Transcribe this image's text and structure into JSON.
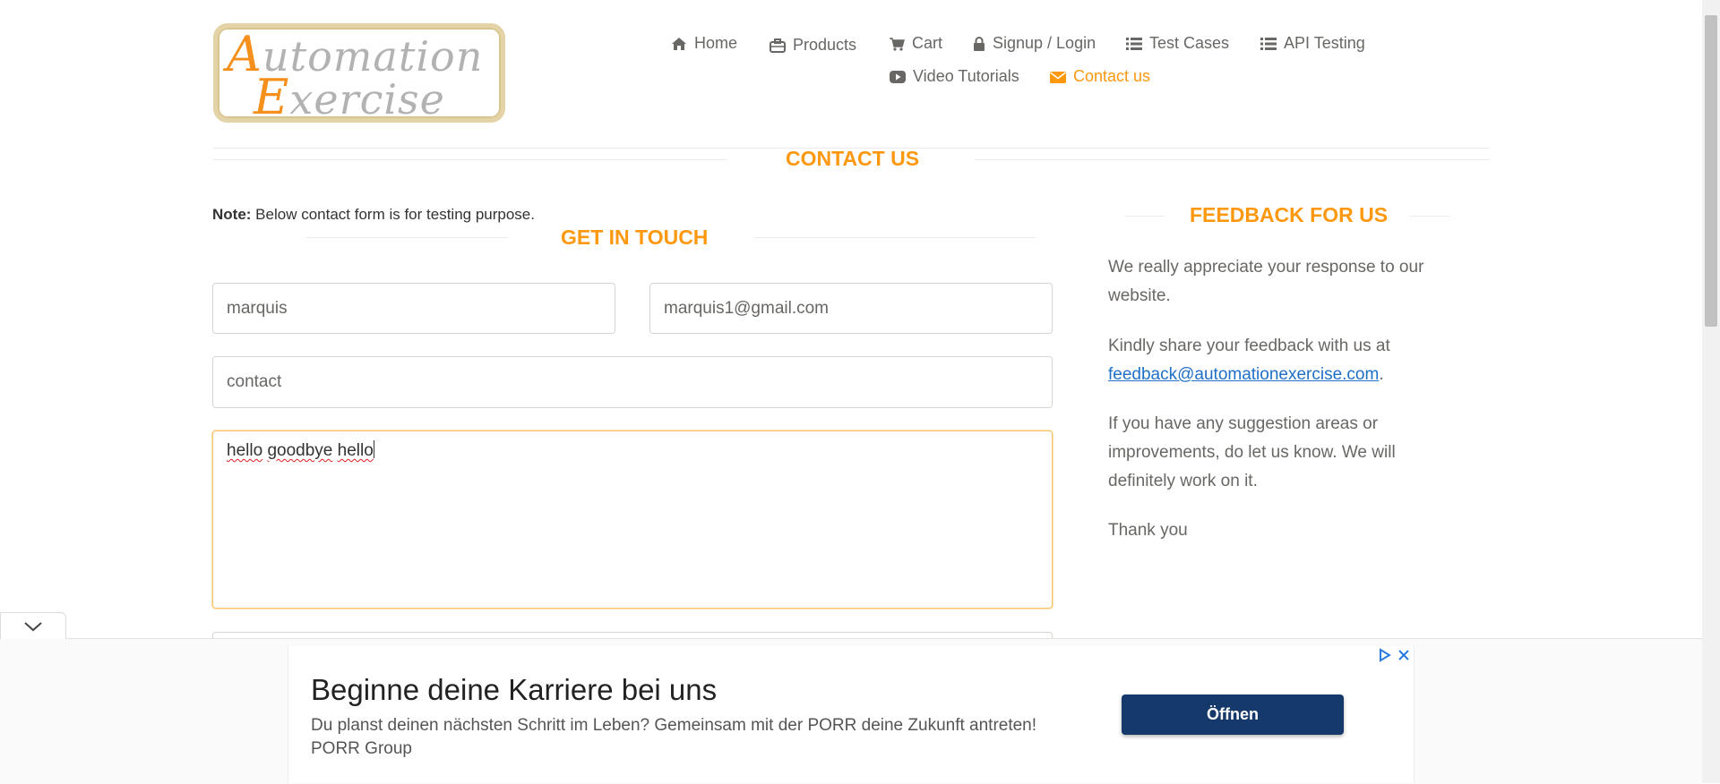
{
  "logo": {
    "line1_cap": "A",
    "line1_rest": "utomation",
    "line2_cap": "E",
    "line2_rest": "xercise"
  },
  "nav": {
    "items": [
      {
        "label": "Home",
        "icon": "home-icon"
      },
      {
        "label": "Products",
        "icon": "briefcase-icon"
      },
      {
        "label": "Cart",
        "icon": "cart-icon"
      },
      {
        "label": "Signup / Login",
        "icon": "lock-icon"
      },
      {
        "label": "Test Cases",
        "icon": "list-icon"
      },
      {
        "label": "API Testing",
        "icon": "list-icon"
      },
      {
        "label": "Video Tutorials",
        "icon": "youtube-icon"
      },
      {
        "label": "Contact us",
        "icon": "envelope-icon",
        "active": true
      }
    ]
  },
  "contact": {
    "title": "CONTACT US",
    "note_bold": "Note:",
    "note_text": " Below contact form is for testing purpose.",
    "get_in_touch": "GET IN TOUCH",
    "form": {
      "name_value": "marquis",
      "email_value": "marquis1@gmail.com",
      "subject_value": "contact",
      "message_words": [
        "hello",
        "goodbye",
        "hello"
      ]
    }
  },
  "feedback": {
    "title": "FEEDBACK FOR US",
    "p1": "We really appreciate your response to our website.",
    "p2_prefix": "Kindly share your feedback with us at ",
    "p2_link": "feedback@automationexercise.com",
    "p2_suffix": ".",
    "p3": "If you have any suggestion areas or improvements, do let us know. We will definitely work on it.",
    "p4": "Thank you"
  },
  "ad": {
    "title": "Beginne deine Karriere bei uns",
    "description": "Du planst deinen nächsten Schritt im Leben? Gemeinsam mit der PORR deine Zukunft antreten! PORR Group",
    "button": "Öffnen"
  },
  "colors": {
    "accent": "#fe980f",
    "link": "#1f6fc6",
    "ad_button": "#16396b"
  }
}
